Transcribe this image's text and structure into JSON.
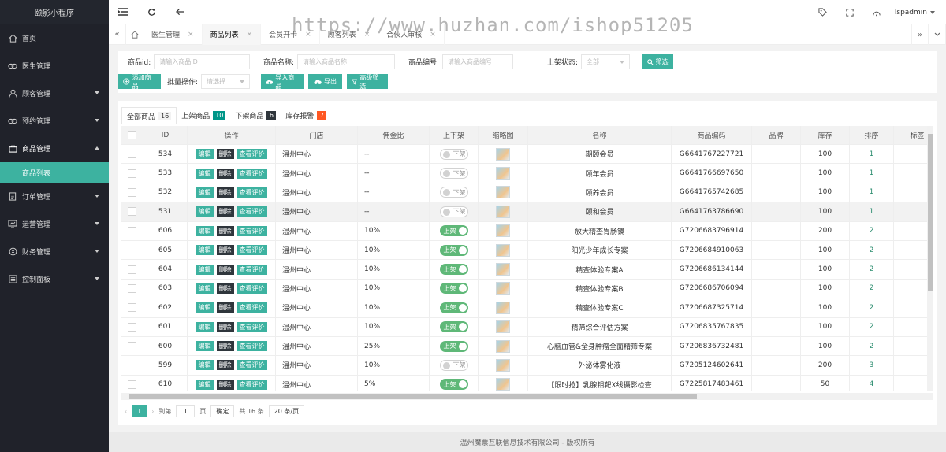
{
  "app_title": "颐影小程序",
  "sidebar": {
    "items": [
      {
        "label": "首页",
        "icon": "home-icon",
        "expandable": false
      },
      {
        "label": "医生管理",
        "icon": "link-icon",
        "expandable": false
      },
      {
        "label": "顾客管理",
        "icon": "user-icon",
        "expandable": true
      },
      {
        "label": "预约管理",
        "icon": "link-icon",
        "expandable": true
      },
      {
        "label": "商品管理",
        "icon": "bag-icon",
        "expandable": true,
        "expanded": true
      },
      {
        "label": "订单管理",
        "icon": "order-icon",
        "expandable": true
      },
      {
        "label": "运营管理",
        "icon": "chart-icon",
        "expandable": true
      },
      {
        "label": "财务管理",
        "icon": "coin-icon",
        "expandable": true
      },
      {
        "label": "控制面板",
        "icon": "panel-icon",
        "expandable": true
      }
    ],
    "subitem": "商品列表"
  },
  "topbar": {
    "user": "lspadmin"
  },
  "watermark": "https://www.huzhan.com/ishop51205",
  "tabs": [
    {
      "label": "医生管理",
      "active": false
    },
    {
      "label": "商品列表",
      "active": true
    },
    {
      "label": "会员开卡",
      "active": false
    },
    {
      "label": "顾客列表",
      "active": false
    },
    {
      "label": "合伙人审核",
      "active": false
    }
  ],
  "filters": {
    "id_label": "商品id:",
    "id_placeholder": "请输入商品ID",
    "name_label": "商品名称:",
    "name_placeholder": "请输入商品名称",
    "code_label": "商品编号:",
    "code_placeholder": "请输入商品编号",
    "status_label": "上架状态:",
    "status_value": "全部",
    "search_btn": "筛选",
    "add_btn": "添加商品",
    "batch_label": "批量操作:",
    "batch_placeholder": "请选择",
    "import_btn": "导入商品",
    "export_btn": "导出",
    "advanced_btn": "高级筛选"
  },
  "ptabs": [
    {
      "label": "全部商品",
      "count": "16",
      "color": "#f2f2f2",
      "text_color": "#333"
    },
    {
      "label": "上架商品",
      "count": "10",
      "color": "#009688",
      "text_color": "#fff"
    },
    {
      "label": "下架商品",
      "count": "6",
      "color": "#2f363c",
      "text_color": "#fff"
    },
    {
      "label": "库存报警",
      "count": "7",
      "color": "#ff5722",
      "text_color": "#fff"
    }
  ],
  "columns": [
    "ID",
    "操作",
    "门店",
    "佣金比",
    "上下架",
    "缩略图",
    "名称",
    "商品编码",
    "品牌",
    "库存",
    "排序",
    "标签"
  ],
  "actions": {
    "edit": "编辑",
    "del": "删除",
    "review": "查看评价"
  },
  "toggle": {
    "on": "上架",
    "off": "下架"
  },
  "rows": [
    {
      "id": "534",
      "store": "温州中心",
      "ratio": "--",
      "on": false,
      "name": "期颐会员",
      "code": "G6641767227721",
      "stock": "100",
      "sort": "1"
    },
    {
      "id": "533",
      "store": "温州中心",
      "ratio": "--",
      "on": false,
      "name": "颐年会员",
      "code": "G6641766697650",
      "stock": "100",
      "sort": "1"
    },
    {
      "id": "532",
      "store": "温州中心",
      "ratio": "--",
      "on": false,
      "name": "颐养会员",
      "code": "G6641765742685",
      "stock": "100",
      "sort": "1"
    },
    {
      "id": "531",
      "store": "温州中心",
      "ratio": "--",
      "on": false,
      "name": "颐和会员",
      "code": "G6641763786690",
      "stock": "100",
      "sort": "1"
    },
    {
      "id": "606",
      "store": "温州中心",
      "ratio": "10%",
      "on": true,
      "name": "放大精查胃肠镜",
      "code": "G7206683796914",
      "stock": "200",
      "sort": "2"
    },
    {
      "id": "605",
      "store": "温州中心",
      "ratio": "10%",
      "on": true,
      "name": "阳光少年成长专案",
      "code": "G7206684910063",
      "stock": "100",
      "sort": "2"
    },
    {
      "id": "604",
      "store": "温州中心",
      "ratio": "10%",
      "on": true,
      "name": "精查体验专案A",
      "code": "G7206686134144",
      "stock": "100",
      "sort": "2"
    },
    {
      "id": "603",
      "store": "温州中心",
      "ratio": "10%",
      "on": true,
      "name": "精查体验专案B",
      "code": "G7206686706094",
      "stock": "100",
      "sort": "2"
    },
    {
      "id": "602",
      "store": "温州中心",
      "ratio": "10%",
      "on": true,
      "name": "精查体验专案C",
      "code": "G7206687325714",
      "stock": "100",
      "sort": "2"
    },
    {
      "id": "601",
      "store": "温州中心",
      "ratio": "10%",
      "on": true,
      "name": "精筛综合评估方案",
      "code": "G7206835767835",
      "stock": "100",
      "sort": "2"
    },
    {
      "id": "600",
      "store": "温州中心",
      "ratio": "25%",
      "on": true,
      "name": "心脑血管&全身肿瘤全面精筛专案",
      "code": "G7206836732481",
      "stock": "100",
      "sort": "2"
    },
    {
      "id": "599",
      "store": "温州中心",
      "ratio": "10%",
      "on": false,
      "name": "外泌体雾化液",
      "code": "G7205124602641",
      "stock": "200",
      "sort": "3"
    },
    {
      "id": "610",
      "store": "温州中心",
      "ratio": "5%",
      "on": true,
      "name": "【限时抢】乳腺钼靶X线摄影检查",
      "code": "G7225817483461",
      "stock": "50",
      "sort": "4"
    }
  ],
  "pager": {
    "current": "1",
    "goto_label": "到第",
    "goto_value": "1",
    "page_unit": "页",
    "confirm": "确定",
    "total": "共 16 条",
    "size": "20 条/页"
  },
  "footer": "温州魔票互联信息技术有限公司 - 版权所有"
}
